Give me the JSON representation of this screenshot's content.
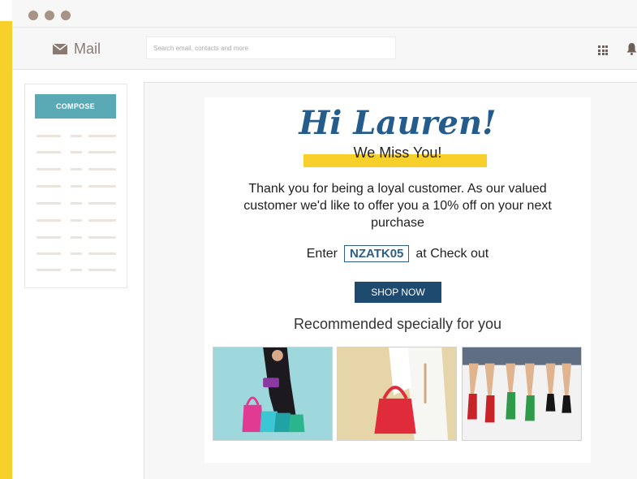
{
  "app": {
    "name": "Mail"
  },
  "search": {
    "placeholder": "Search email, contacts and more"
  },
  "sidebar": {
    "compose_label": "COMPOSE"
  },
  "email": {
    "greeting": "Hi Lauren!",
    "subheading": "We Miss You!",
    "message": "Thank you for being a loyal customer. As our valued customer we'd like to offer you a 10% off on your next purchase",
    "enter_label": "Enter",
    "promo_code": "NZATK05",
    "checkout_label": "at Check out",
    "cta_label": "SHOP NOW",
    "recommend_heading": "Recommended specially for you"
  },
  "colors": {
    "accent_yellow": "#f8d02c",
    "compose_teal": "#5aaab5",
    "cta_navy": "#1e4a70",
    "greeting_blue": "#245c8c"
  }
}
